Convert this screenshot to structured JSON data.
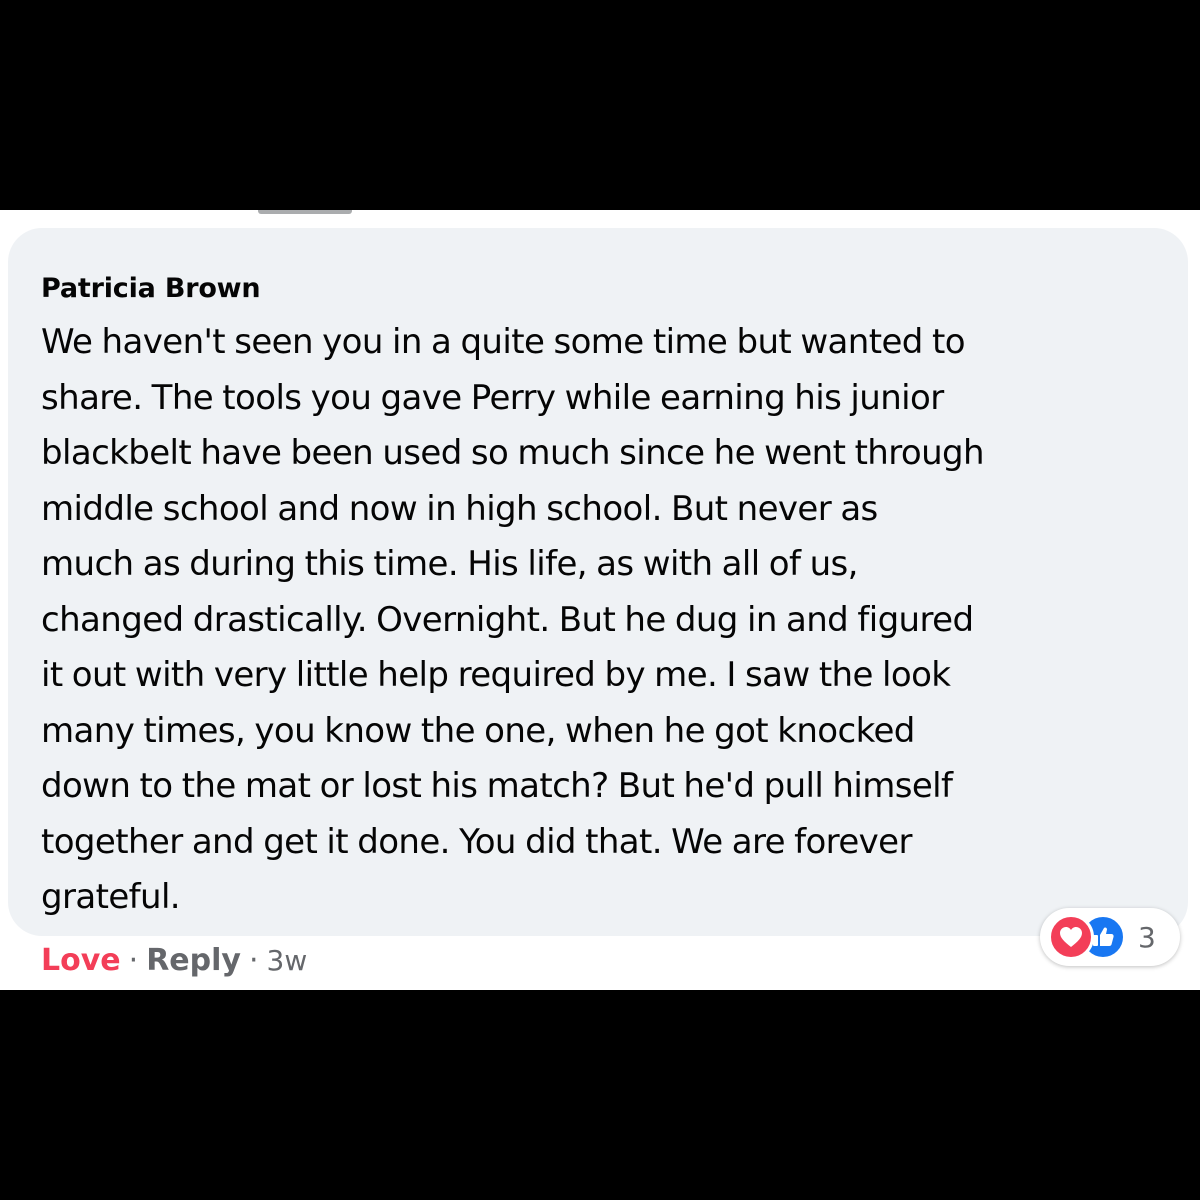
{
  "comment": {
    "author": "Patricia Brown",
    "text": "We haven't seen you in a quite some time but wanted to\nshare. The tools you gave Perry while earning his junior\nblackbelt have been used so much since he went through\nmiddle school and now in high school. But never as\nmuch as during this time. His life, as with all of us,\nchanged drastically. Overnight. But he dug in and figured\nit out with very little help required by me. I saw the look\nmany times, you know the one, when he got knocked\ndown to the mat or lost his match? But he'd pull himself\ntogether and get it done. You did that. We are forever\ngrateful."
  },
  "actions": {
    "love_label": "Love",
    "reply_label": "Reply",
    "separator": "·",
    "timestamp": "3w"
  },
  "reactions": {
    "icons": [
      "love-icon",
      "like-icon"
    ],
    "count": "3"
  },
  "colors": {
    "love": "#f33e58",
    "like": "#1877f2",
    "bubble": "#eff2f5",
    "muted_text": "#65676b"
  }
}
